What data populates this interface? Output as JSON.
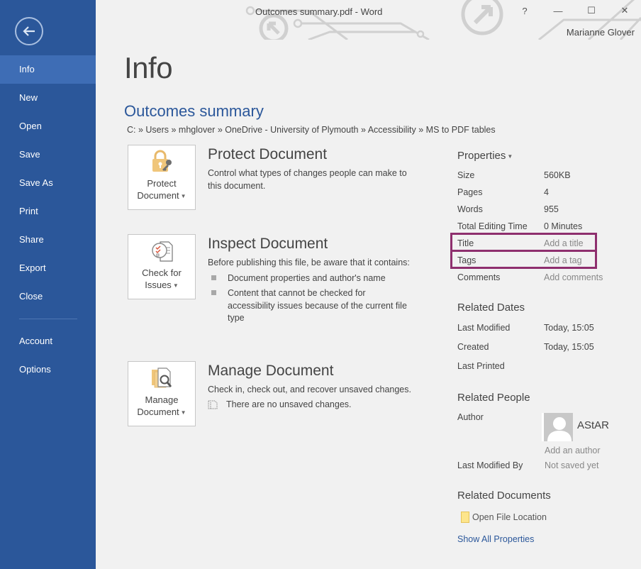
{
  "window": {
    "title": "Outcomes summary.pdf - Word",
    "user": "Marianne Glover",
    "help_label": "?",
    "minimize_label": "—",
    "maximize_label": "☐",
    "close_label": "✕"
  },
  "sidebar": {
    "back_icon": "back-arrow-icon",
    "items": [
      {
        "label": "Info",
        "active": true
      },
      {
        "label": "New"
      },
      {
        "label": "Open"
      },
      {
        "label": "Save"
      },
      {
        "label": "Save As"
      },
      {
        "label": "Print"
      },
      {
        "label": "Share"
      },
      {
        "label": "Export"
      },
      {
        "label": "Close"
      }
    ],
    "bottom_items": [
      {
        "label": "Account"
      },
      {
        "label": "Options"
      }
    ]
  },
  "main": {
    "page_title": "Info",
    "doc_title": "Outcomes summary",
    "doc_path": "C: » Users » mhglover » OneDrive - University of Plymouth » Accessibility » MS to PDF tables",
    "sections": {
      "protect": {
        "button_line1": "Protect",
        "button_line2": "Document",
        "title": "Protect Document",
        "desc": "Control what types of changes people can make to this document."
      },
      "inspect": {
        "button_line1": "Check for",
        "button_line2": "Issues",
        "title": "Inspect Document",
        "desc": "Before publishing this file, be aware that it contains:",
        "bullets": [
          "Document properties and author's name",
          "Content that cannot be checked for accessibility issues because of the current file type"
        ]
      },
      "manage": {
        "button_line1": "Manage",
        "button_line2": "Document",
        "title": "Manage Document",
        "desc": "Check in, check out, and recover unsaved changes.",
        "status": "There are no unsaved changes."
      }
    }
  },
  "properties": {
    "heading": "Properties",
    "rows": [
      {
        "key": "Size",
        "value": "560KB"
      },
      {
        "key": "Pages",
        "value": "4"
      },
      {
        "key": "Words",
        "value": "955"
      },
      {
        "key": "Total Editing Time",
        "value": "0 Minutes"
      },
      {
        "key": "Title",
        "value": "Add a title"
      },
      {
        "key": "Tags",
        "value": "Add a tag"
      },
      {
        "key": "Comments",
        "value": "Add comments"
      }
    ],
    "highlight_color": "#8e2f6e",
    "related_dates": {
      "heading": "Related Dates",
      "rows": [
        {
          "key": "Last Modified",
          "value": "Today, 15:05"
        },
        {
          "key": "Created",
          "value": "Today, 15:05"
        },
        {
          "key": "Last Printed",
          "value": ""
        }
      ]
    },
    "related_people": {
      "heading": "Related People",
      "author_label": "Author",
      "author_name": "AStAR",
      "add_author": "Add an author",
      "last_modified_by_label": "Last Modified By",
      "last_modified_by_value": "Not saved yet"
    },
    "related_documents": {
      "heading": "Related Documents",
      "open_location": "Open File Location"
    },
    "show_all": "Show All Properties"
  },
  "colors": {
    "sidebar": "#2b579a",
    "sidebar_active": "#3e6db5",
    "accent": "#2b579a",
    "background": "#f1f1f1"
  }
}
